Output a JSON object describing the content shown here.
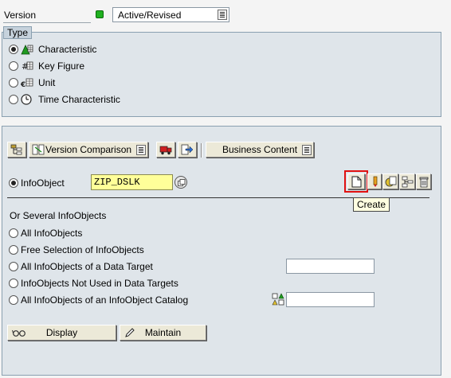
{
  "version": {
    "label": "Version",
    "dropdown_value": "Active/Revised",
    "status_color": "#1fb01f"
  },
  "type_group": {
    "title": "Type",
    "options": [
      {
        "label": "Characteristic",
        "icon": "characteristic-icon",
        "selected": true
      },
      {
        "label": "Key Figure",
        "icon": "key-figure-icon",
        "selected": false
      },
      {
        "label": "Unit",
        "icon": "unit-icon",
        "selected": false
      },
      {
        "label": "Time Characteristic",
        "icon": "clock-icon",
        "selected": false
      }
    ]
  },
  "toolbar": {
    "version_comparison_label": "Version Comparison",
    "business_content_label": "Business Content"
  },
  "infoobject": {
    "label": "InfoObject",
    "value": "ZIP_DSLK",
    "selected": true
  },
  "actions": {
    "create_tooltip": "Create"
  },
  "several": {
    "title": "Or Several InfoObjects",
    "options": [
      {
        "label": "All InfoObjects"
      },
      {
        "label": "Free Selection of InfoObjects"
      },
      {
        "label": "All InfoObjects of a Data Target"
      },
      {
        "label": "InfoObjects Not Used in Data Targets"
      },
      {
        "label": "All InfoObjects of an InfoObject Catalog"
      }
    ]
  },
  "buttons": {
    "display_label": "Display",
    "maintain_label": "Maintain"
  }
}
